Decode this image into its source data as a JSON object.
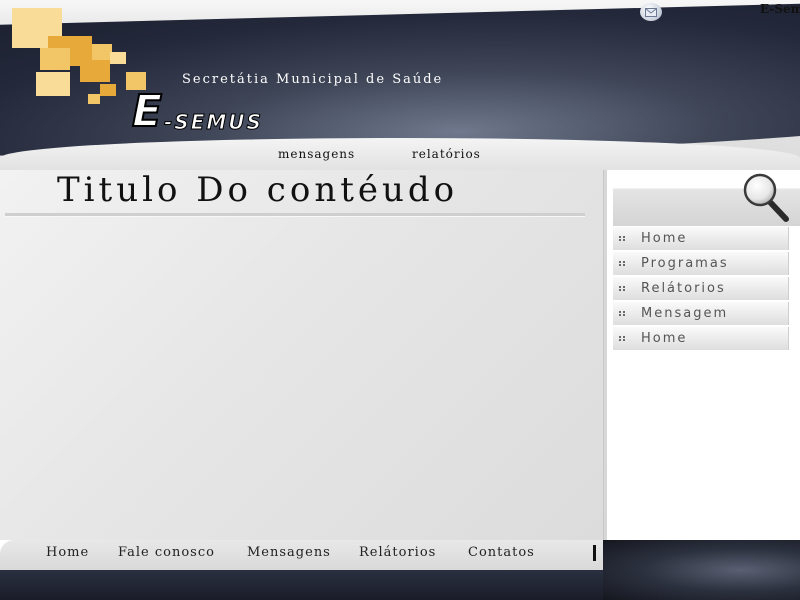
{
  "header": {
    "brand_top": "E-Sem",
    "subtitle": "Secretátia Municipal de Saúde",
    "logo_letter": "E",
    "logo_rest": "-SEMUS",
    "nav": [
      {
        "label": "mensagens"
      },
      {
        "label": "relatórios"
      }
    ],
    "icons": {
      "mail": "mail-icon",
      "search": "search-icon"
    }
  },
  "content": {
    "title": "Titulo Do contéudo"
  },
  "sidebar": {
    "items": [
      {
        "label": "Home"
      },
      {
        "label": "Programas"
      },
      {
        "label": "Relátorios"
      },
      {
        "label": "Mensagem"
      },
      {
        "label": "Home"
      }
    ]
  },
  "footer": {
    "links": [
      {
        "label": "Home"
      },
      {
        "label": "Fale conosco"
      },
      {
        "label": "Mensagens"
      },
      {
        "label": "Relátorios"
      },
      {
        "label": "Contatos"
      }
    ]
  },
  "colors": {
    "header_dark": "#23283a",
    "accent_squares": "#f2c566",
    "footer_dark": "#1a1d28"
  }
}
